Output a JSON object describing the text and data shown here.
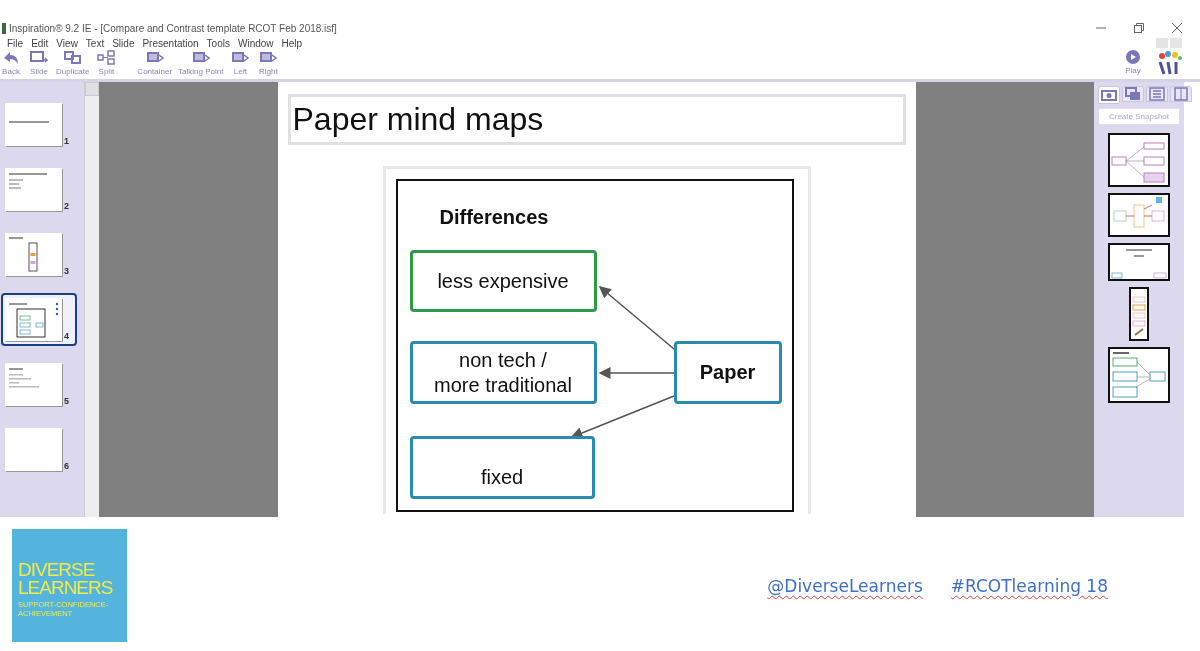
{
  "window": {
    "title": "Inspiration® 9.2 IE - [Compare and Contrast template RCOT Feb 2018.isf]"
  },
  "menu": [
    "File",
    "Edit",
    "View",
    "Text",
    "Slide",
    "Presentation",
    "Tools",
    "Window",
    "Help"
  ],
  "toolbar": [
    {
      "label": "Back",
      "kind": "back"
    },
    {
      "label": "Slide",
      "kind": "slide"
    },
    {
      "label": "Duplicate",
      "kind": "duplicate"
    },
    {
      "label": "Split",
      "kind": "split"
    },
    {
      "label": "Container",
      "kind": "list"
    },
    {
      "label": "Talking Point",
      "kind": "list"
    },
    {
      "label": "Left",
      "kind": "list"
    },
    {
      "label": "Right",
      "kind": "list"
    }
  ],
  "play": {
    "label": "Play"
  },
  "slides": [
    {
      "number": "1",
      "selected": false
    },
    {
      "number": "2",
      "selected": false
    },
    {
      "number": "3",
      "selected": false
    },
    {
      "number": "4",
      "selected": true
    },
    {
      "number": "5",
      "selected": false
    },
    {
      "number": "6",
      "selected": false
    }
  ],
  "slide": {
    "title": "Paper mind maps",
    "diagram": {
      "heading": "Differences",
      "center": "Paper",
      "nodes": [
        {
          "text": "less expensive",
          "color": "#2e9a4a"
        },
        {
          "text": "non tech /\nmore traditional",
          "color": "#2a8ab0"
        },
        {
          "text": "fixed",
          "color": "#2a8ab0"
        }
      ]
    }
  },
  "snapshot_panel": {
    "tabs": [
      {
        "kind": "camera",
        "selected": true
      },
      {
        "kind": "windows",
        "selected": false
      },
      {
        "kind": "list",
        "selected": false
      },
      {
        "kind": "page",
        "selected": false
      }
    ],
    "button": "Create Snapshot"
  },
  "footer": {
    "logo": {
      "line1": "DIVERSE",
      "line2": "LEARNERS",
      "tagline": "SUPPORT-CONFIDENCE-ACHIEVEMENT"
    },
    "handle": "@DiverseLearners",
    "hashtag": "#RCOTlearning 18"
  }
}
